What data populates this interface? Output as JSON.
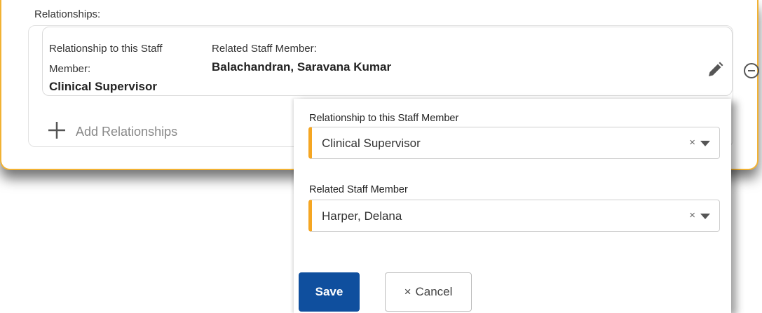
{
  "relationships": {
    "section_label": "Relationships:",
    "items": [
      {
        "relationship_label": "Relationship to this Staff Member:",
        "relationship_value": "Clinical Supervisor",
        "related_label": "Related Staff Member:",
        "related_value": "Balachandran, Saravana Kumar",
        "edit_icon": "pencil-icon",
        "remove_icon": "minus-circle-icon"
      }
    ],
    "add_label": "Add Relationships",
    "add_icon": "plus-icon"
  },
  "form": {
    "relationship_field": {
      "label": "Relationship to this Staff Member",
      "value": "Clinical Supervisor"
    },
    "related_field": {
      "label": "Related Staff Member",
      "value": "Harper, Delana"
    },
    "clear_symbol": "×",
    "save_label": "Save",
    "cancel_label": "Cancel",
    "cancel_icon": "×"
  },
  "colors": {
    "accent": "#f5a623",
    "card_border": "#f2b233",
    "primary_button": "#0f4f9e"
  }
}
